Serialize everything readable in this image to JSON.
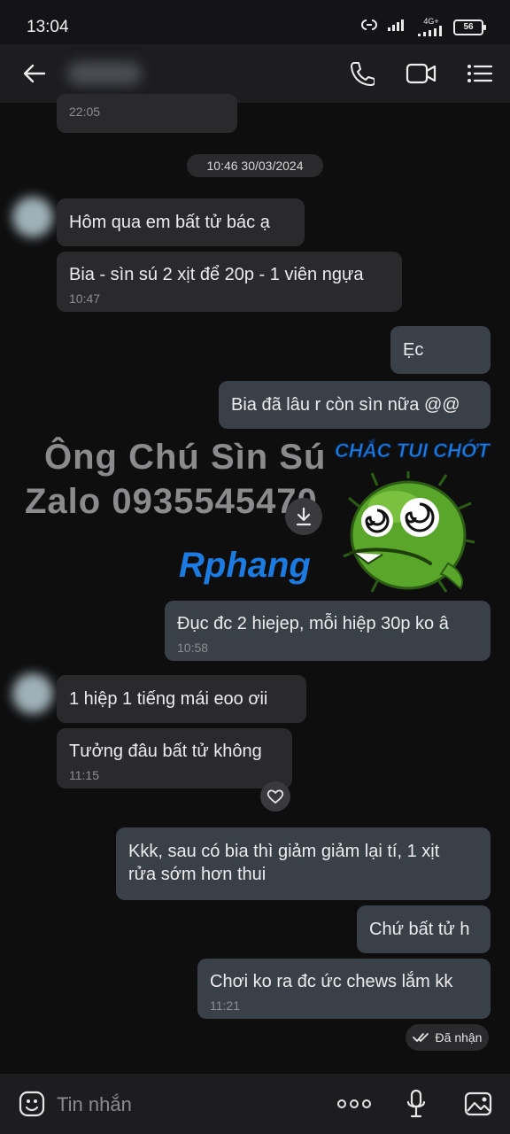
{
  "status_bar": {
    "time": "13:04",
    "network": "4G+",
    "battery": "56"
  },
  "header": {
    "back_label": "back",
    "contact_name": "",
    "call_label": "call",
    "video_label": "video call",
    "menu_label": "menu"
  },
  "chat": {
    "partial_timestamp": "22:05",
    "date_separator": "10:46 30/03/2024",
    "messages": [
      {
        "side": "incoming",
        "text": "Hôm qua em bất tử bác ạ",
        "time": ""
      },
      {
        "side": "incoming",
        "text": "Bia - sìn sú 2 xịt để 20p - 1 viên ngựa",
        "time": "10:47"
      },
      {
        "side": "outgoing",
        "text": "Ẹc",
        "time": ""
      },
      {
        "side": "outgoing",
        "text": "Bia đã lâu r còn sìn nữa @@",
        "time": ""
      },
      {
        "side": "outgoing",
        "text": "Đục đc 2 hiejep, mỗi hiệp 30p ko â",
        "time": "10:58"
      },
      {
        "side": "incoming",
        "text": "1 hiệp 1 tiếng mái eoo ơii",
        "time": ""
      },
      {
        "side": "incoming",
        "text": "Tưởng đâu bất tử không",
        "time": "11:15"
      },
      {
        "side": "outgoing",
        "text_line1": "Kkk, sau có bia thì giảm giảm lại tí, 1 xịt",
        "text_line2": "rửa sớm hơn thui",
        "time": ""
      },
      {
        "side": "outgoing",
        "text": "Chứ bất tử h",
        "time": ""
      },
      {
        "side": "outgoing",
        "text": "Chơi ko ra đc ức chews lắm kk",
        "time": "11:21"
      }
    ],
    "received_label": "Đã nhận"
  },
  "watermark": {
    "line1": "Ông Chú Sìn Sú",
    "line2": "Zalo 0935545470",
    "sticker_caption": "CHẮC TUI CHỚT",
    "logo_text": "Rphang",
    "colors": {
      "caption": "#1c7fe8",
      "logo_red": "#e0242d",
      "logo_blue": "#1b7be0",
      "sticker_green": "#5aa62a"
    }
  },
  "composer": {
    "placeholder": "Tin nhắn"
  }
}
